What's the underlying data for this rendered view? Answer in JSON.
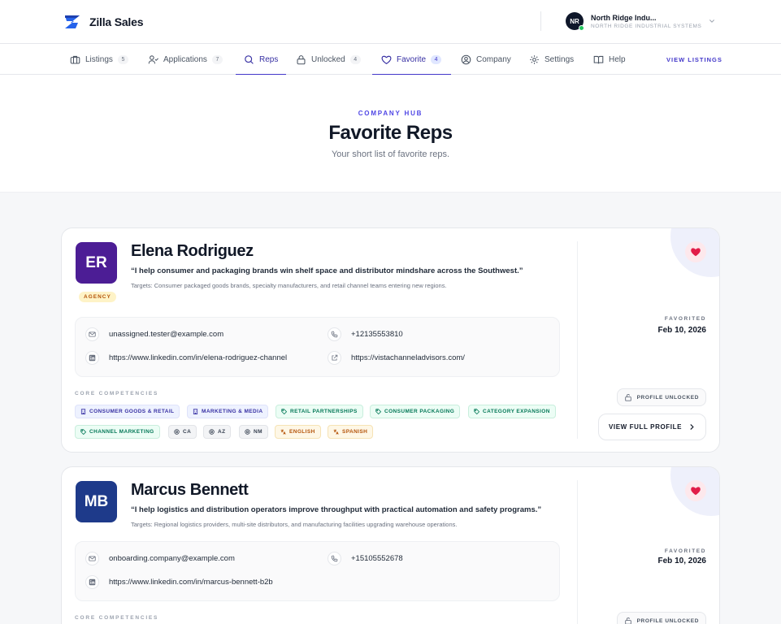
{
  "brand": {
    "name": "Zilla Sales"
  },
  "account": {
    "initials": "NR",
    "name": "North Ridge Indu...",
    "company": "NORTH RIDGE INDUSTRIAL SYSTEMS"
  },
  "nav": {
    "items": [
      {
        "label": "Listings",
        "count": "5",
        "icon": "briefcase-icon"
      },
      {
        "label": "Applications",
        "count": "7",
        "icon": "user-check-icon"
      },
      {
        "label": "Reps",
        "icon": "search-icon",
        "active": true
      },
      {
        "label": "Unlocked",
        "count": "4",
        "icon": "lock-icon"
      },
      {
        "label": "Favorite",
        "count": "4",
        "icon": "heart-icon",
        "active": true
      },
      {
        "label": "Company",
        "icon": "user-circle-icon"
      },
      {
        "label": "Settings",
        "icon": "gear-icon"
      },
      {
        "label": "Help",
        "icon": "book-icon"
      }
    ],
    "view_listings": "VIEW LISTINGS"
  },
  "hero": {
    "eyebrow": "COMPANY HUB",
    "title": "Favorite Reps",
    "subtitle": "Your short list of favorite reps."
  },
  "labels": {
    "core_competencies": "CORE COMPETENCIES",
    "favorited": "FAVORITED",
    "profile_unlocked": "PROFILE UNLOCKED",
    "view_full_profile": "VIEW FULL PROFILE"
  },
  "reps": [
    {
      "initials": "ER",
      "avatar_color": "#4c1d95",
      "badge": "AGENCY",
      "name": "Elena Rodriguez",
      "quote": "“I help consumer and packaging brands win shelf space and distributor mindshare across the Southwest.”",
      "targets": "Targets: Consumer packaged goods brands, specialty manufacturers, and retail channel teams entering new regions.",
      "email": "unassigned.tester@example.com",
      "phone": "+12135553810",
      "linkedin": "https://www.linkedin.com/in/elena-rodriguez-channel",
      "website": "https://vistachanneladvisors.com/",
      "chips": [
        "CONSUMER GOODS & RETAIL",
        "MARKETING & MEDIA",
        "RETAIL PARTNERSHIPS",
        "CONSUMER PACKAGING",
        "CATEGORY EXPANSION",
        "CHANNEL MARKETING",
        "CA",
        "AZ",
        "NM",
        "ENGLISH",
        "SPANISH"
      ],
      "favorited": "Feb 10, 2026"
    },
    {
      "initials": "MB",
      "avatar_color": "#1e3a8a",
      "name": "Marcus Bennett",
      "quote": "“I help logistics and distribution operators improve throughput with practical automation and safety programs.”",
      "targets": "Targets: Regional logistics providers, multi-site distributors, and manufacturing facilities upgrading warehouse operations.",
      "email": "onboarding.company@example.com",
      "phone": "+15105552678",
      "linkedin": "https://www.linkedin.com/in/marcus-bennett-b2b",
      "favorited": "Feb 10, 2026"
    }
  ],
  "colors": {
    "accent": "#4338ca",
    "heart": "#e11d48"
  }
}
